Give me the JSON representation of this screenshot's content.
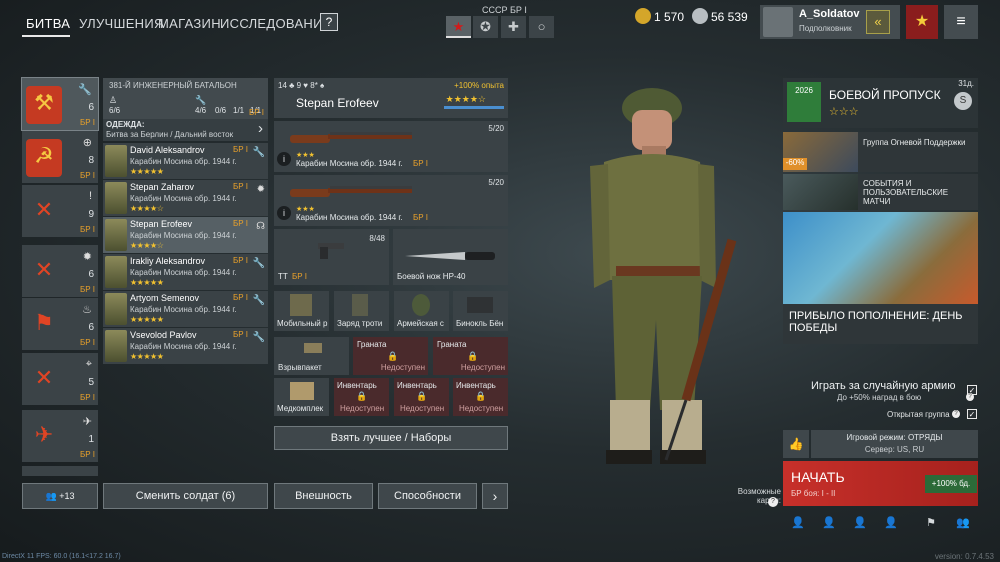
{
  "nav": {
    "tabs": [
      "БИТВА",
      "УЛУЧШЕНИЯ",
      "МАГАЗИН",
      "ИССЛЕДОВАНИЯ"
    ],
    "help": "?",
    "nation": "СССР БР I"
  },
  "currency": {
    "gold": "1 570",
    "silver": "56 539"
  },
  "profile": {
    "name": "A_Soldatov",
    "rank": "Подполковник"
  },
  "squads": [
    {
      "count": "6",
      "br": "БР I",
      "icon": "wrench-icon"
    },
    {
      "count": "8",
      "br": "БР I",
      "icon": "plus-icon"
    },
    {
      "count": "9",
      "br": "БР I",
      "icon": "exclamation-icon"
    },
    {
      "count": "6",
      "br": "БР I",
      "icon": "explosion-icon"
    },
    {
      "count": "6",
      "br": "БР I",
      "icon": "flame-icon"
    },
    {
      "count": "5",
      "br": "БР I",
      "icon": "crosshair-icon"
    },
    {
      "count": "1",
      "br": "БР I",
      "icon": "plane-icon"
    }
  ],
  "unit": {
    "title": "381-Й ИНЖЕНЕРНЫЙ БАТАЛЬОН",
    "soldiers": "6/6",
    "eng": "4/6",
    "mg": "0/6",
    "ex": "1/1",
    "rad": "1/1",
    "br": "БР I"
  },
  "outfit": {
    "label": "ОДЕЖДА:",
    "value": "Битва за Берлин / Дальний восток"
  },
  "soldiers": [
    {
      "name": "David Aleksandrov",
      "weapon": "Карабин Мосина обр. 1944 г.",
      "stars": "★★★★★",
      "br": "БР I"
    },
    {
      "name": "Stepan Zaharov",
      "weapon": "Карабин Мосина обр. 1944 г.",
      "stars": "★★★★☆",
      "br": "БР I"
    },
    {
      "name": "Stepan Erofeev",
      "weapon": "Карабин Мосина обр. 1944 г.",
      "stars": "★★★★☆",
      "br": "БР I"
    },
    {
      "name": "Irakliy Aleksandrov",
      "weapon": "Карабин Мосина обр. 1944 г.",
      "stars": "★★★★★",
      "br": "БР I"
    },
    {
      "name": "Artyom Semenov",
      "weapon": "Карабин Мосина обр. 1944 г.",
      "stars": "★★★★★",
      "br": "БР I"
    },
    {
      "name": "Vsevolod Pavlov",
      "weapon": "Карабин Мосина обр. 1944 г.",
      "stars": "★★★★★",
      "br": "БР I"
    }
  ],
  "soldier": {
    "name": "Stepan Erofeev",
    "stats": "14 ♣ 9 ♥ 8* ♠",
    "bonus": "+100% опыта",
    "stars": "★★★★☆"
  },
  "weapons": [
    {
      "name": "Карабин Мосина обр. 1944 г.",
      "br": "БР I",
      "ammo": "5/20",
      "stars": "★★★"
    },
    {
      "name": "Карабин Мосина обр. 1944 г.",
      "br": "БР I",
      "ammo": "5/20",
      "stars": "★★★"
    }
  ],
  "secondary": {
    "pistol": "ТТ",
    "pistol_br": "БР I",
    "pistol_ammo": "8/48",
    "knife": "Боевой нож НР-40"
  },
  "equipment": [
    "Мобильный р",
    "Заряд троти",
    "Армейская с",
    "Бинокль Бён"
  ],
  "grenades": [
    "Взрывпакет",
    "Граната",
    "Граната"
  ],
  "inventory": [
    "Медкомплек",
    "Инвентарь",
    "Инвентарь",
    "Инвентарь"
  ],
  "locked": "Недоступен",
  "buttons": {
    "best": "Взять лучшее / Наборы",
    "change": "Сменить солдат (6)",
    "look": "Внешность",
    "abilities": "Способности",
    "squad_count": "+13",
    "next": "›"
  },
  "battlepass": {
    "title": "БОЕВОЙ ПРОПУСК",
    "days": "31д.",
    "stars": "☆☆☆",
    "level": "2026"
  },
  "events": [
    {
      "label": "Группа Огневой Поддержки",
      "discount": "-60%"
    },
    {
      "label": "СОБЫТИЯ И ПОЛЬЗОВАТЕЛЬСКИЕ МАТЧИ"
    },
    {
      "label": "ПРИБЫЛО ПОПОЛНЕНИЕ: ДЕНЬ ПОБЕДЫ"
    }
  ],
  "options": {
    "random": "Играть за случайную армию",
    "random_bonus": "До +50% наград в бою",
    "open_group": "Открытая группа"
  },
  "mode": {
    "mode": "Игровой режим: ОТРЯДЫ",
    "server": "Сервер: US, RU"
  },
  "start": {
    "label": "НАЧАТЬ",
    "sub": "БР боя: I - II",
    "xp": "+100% бд."
  },
  "maps": {
    "label": "Возможные карты:"
  },
  "fps": "DirectX 11 FPS: 60.0 (16.1<17.2 16.7)",
  "version": "version: 0.7.4.53"
}
